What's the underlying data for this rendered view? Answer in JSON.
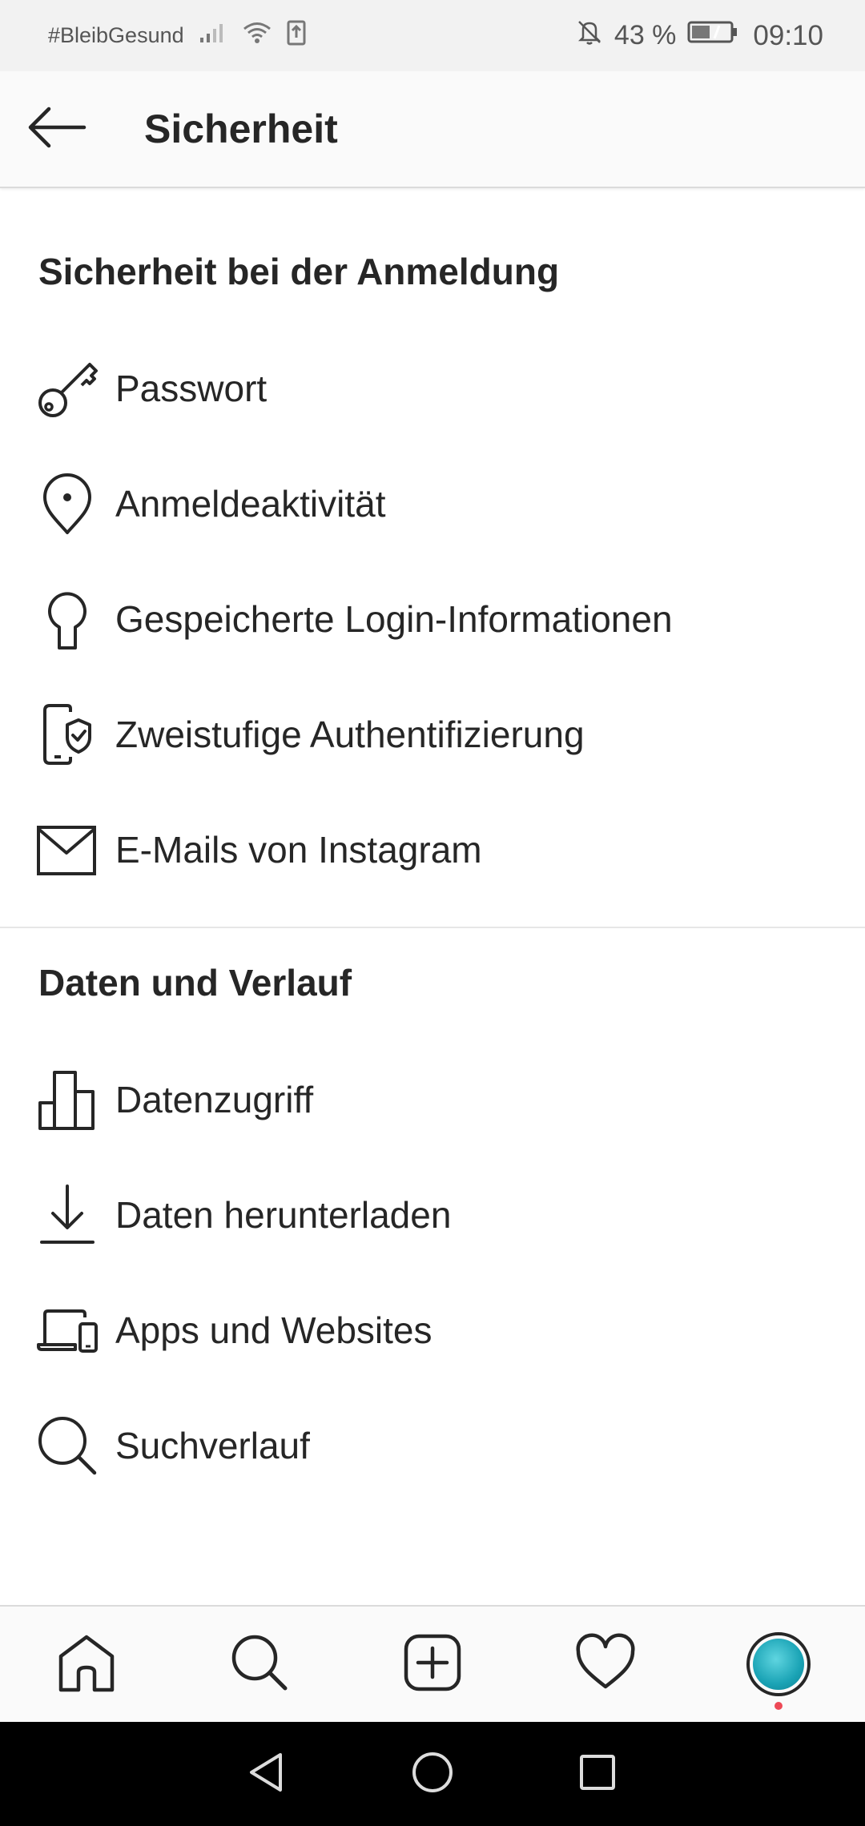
{
  "status_bar": {
    "carrier_text": "#BleibGesund",
    "battery_percent": "43 %",
    "time": "09:10",
    "icons": [
      "signal-icon",
      "wifi-icon",
      "data-transfer-icon",
      "mute-bell-icon",
      "battery-icon"
    ]
  },
  "header": {
    "title": "Sicherheit",
    "back_icon": "back-arrow-icon"
  },
  "sections": [
    {
      "title": "Sicherheit bei der Anmeldung",
      "items": [
        {
          "label": "Passwort",
          "icon": "key-icon"
        },
        {
          "label": "Anmeldeaktivität",
          "icon": "location-pin-icon"
        },
        {
          "label": "Gespeicherte Login-Informationen",
          "icon": "keyhole-icon"
        },
        {
          "label": "Zweistufige Authentifizierung",
          "icon": "phone-shield-icon"
        },
        {
          "label": "E-Mails von Instagram",
          "icon": "mail-icon"
        }
      ]
    },
    {
      "title": "Daten und Verlauf",
      "items": [
        {
          "label": "Datenzugriff",
          "icon": "bar-chart-icon"
        },
        {
          "label": "Daten herunterladen",
          "icon": "download-icon"
        },
        {
          "label": "Apps und Websites",
          "icon": "devices-icon"
        },
        {
          "label": "Suchverlauf",
          "icon": "search-icon"
        }
      ]
    }
  ],
  "bottom_nav": {
    "items": [
      "home-icon",
      "search-icon",
      "new-post-icon",
      "activity-heart-icon",
      "profile-avatar"
    ]
  },
  "system_nav": {
    "items": [
      "back-triangle-icon",
      "home-circle-icon",
      "recents-square-icon"
    ]
  }
}
